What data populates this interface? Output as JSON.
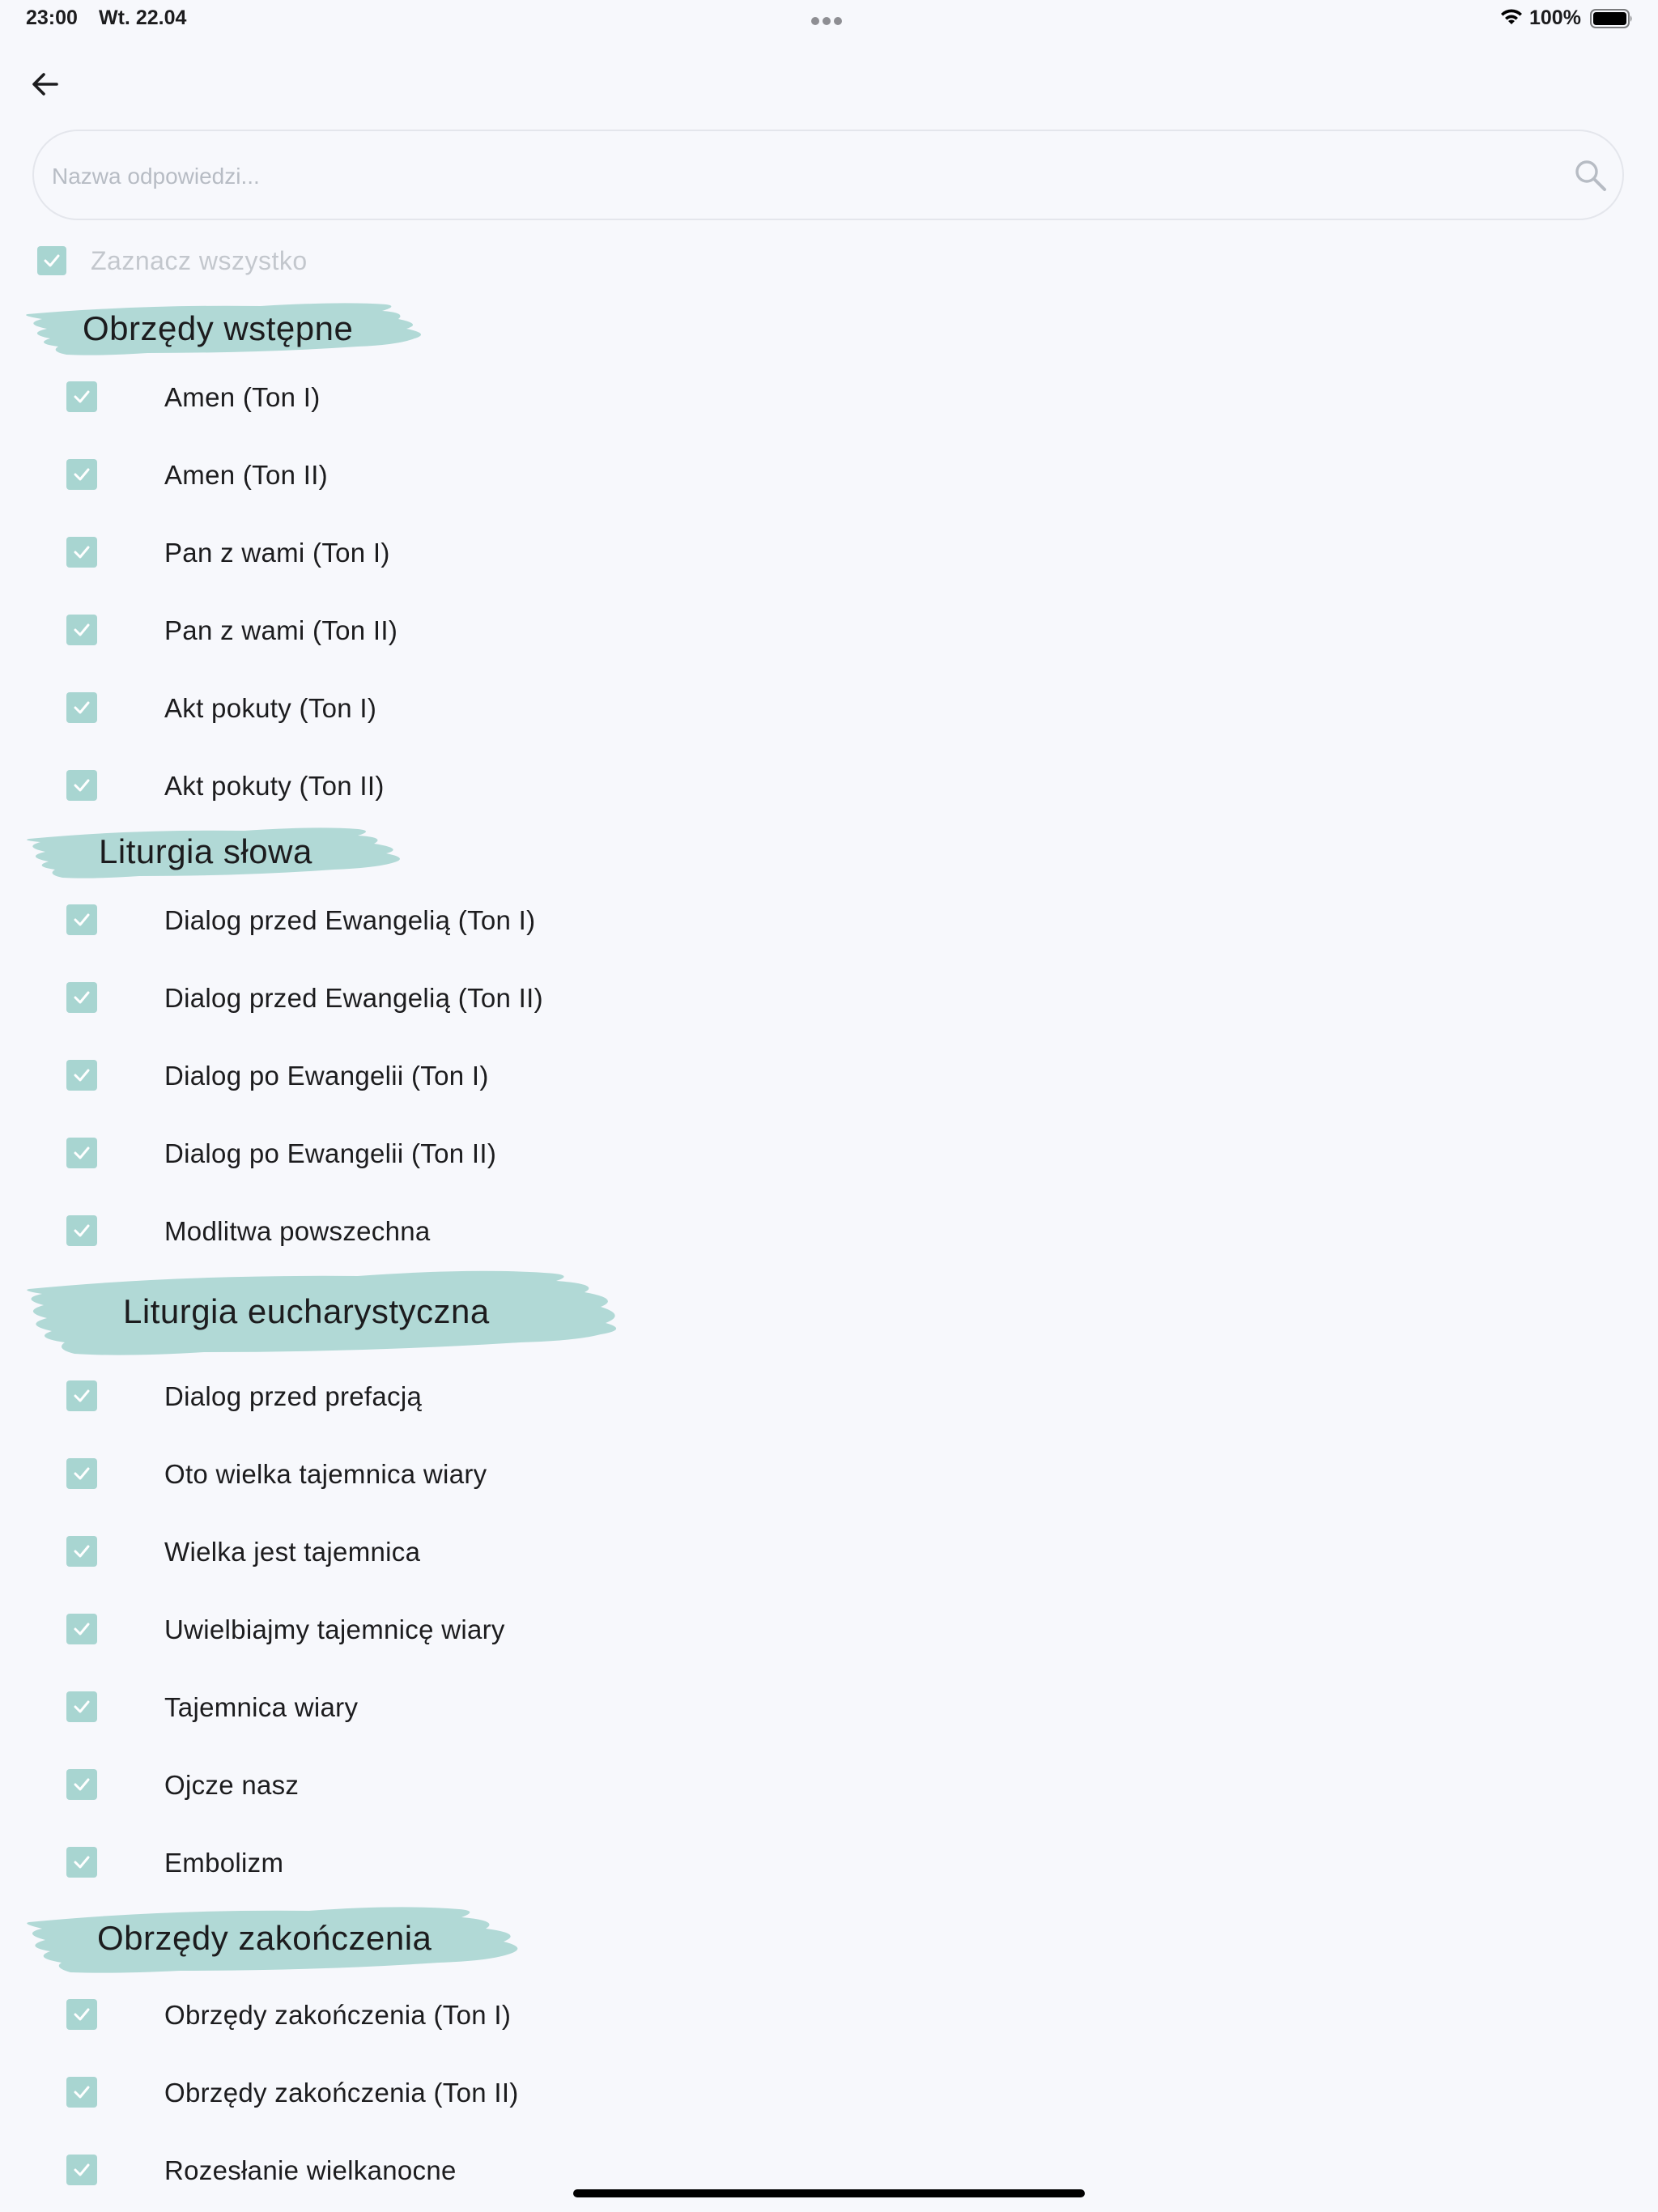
{
  "status_bar": {
    "time": "23:00",
    "date": "Wt. 22.04",
    "battery": "100%"
  },
  "search": {
    "placeholder": "Nazwa odpowiedzi...",
    "value": ""
  },
  "select_all": {
    "label": "Zaznacz wszystko",
    "checked": true
  },
  "colors": {
    "accent": "#a8d5d1",
    "background": "#f7f8fc",
    "text": "#1c1c1e",
    "muted": "#c3c7cd"
  },
  "sections": [
    {
      "title": "Obrzędy wstępne",
      "items": [
        {
          "label": "Amen (Ton I)",
          "checked": true
        },
        {
          "label": "Amen (Ton II)",
          "checked": true
        },
        {
          "label": "Pan z wami (Ton I)",
          "checked": true
        },
        {
          "label": "Pan z wami (Ton II)",
          "checked": true
        },
        {
          "label": "Akt pokuty (Ton I)",
          "checked": true
        },
        {
          "label": "Akt pokuty (Ton II)",
          "checked": true
        }
      ]
    },
    {
      "title": "Liturgia słowa",
      "items": [
        {
          "label": "Dialog przed Ewangelią (Ton I)",
          "checked": true
        },
        {
          "label": "Dialog przed Ewangelią (Ton II)",
          "checked": true
        },
        {
          "label": "Dialog po Ewangelii (Ton I)",
          "checked": true
        },
        {
          "label": "Dialog po Ewangelii (Ton II)",
          "checked": true
        },
        {
          "label": "Modlitwa powszechna",
          "checked": true
        }
      ]
    },
    {
      "title": "Liturgia eucharystyczna",
      "items": [
        {
          "label": "Dialog przed prefacją",
          "checked": true
        },
        {
          "label": "Oto wielka tajemnica wiary",
          "checked": true
        },
        {
          "label": "Wielka jest tajemnica",
          "checked": true
        },
        {
          "label": "Uwielbiajmy tajemnicę wiary",
          "checked": true
        },
        {
          "label": "Tajemnica wiary",
          "checked": true
        },
        {
          "label": "Ojcze nasz",
          "checked": true
        },
        {
          "label": "Embolizm",
          "checked": true
        }
      ]
    },
    {
      "title": "Obrzędy zakończenia",
      "items": [
        {
          "label": "Obrzędy zakończenia (Ton I)",
          "checked": true
        },
        {
          "label": "Obrzędy zakończenia (Ton II)",
          "checked": true
        },
        {
          "label": "Rozesłanie wielkanocne",
          "checked": true
        }
      ]
    }
  ]
}
